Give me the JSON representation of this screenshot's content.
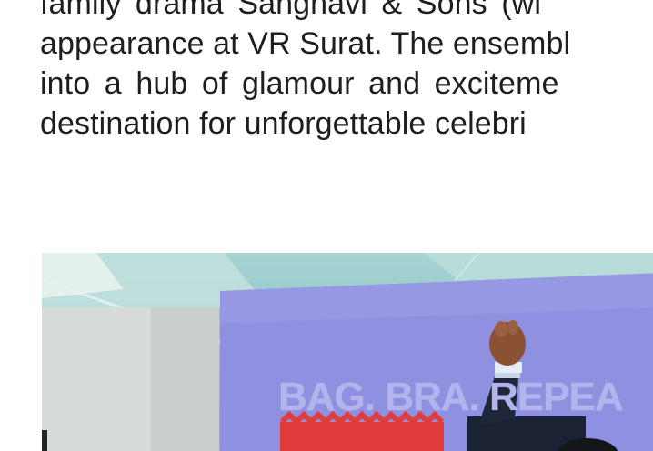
{
  "article": {
    "lines": [
      "family drama Sanghavi & Sons (wi",
      "appearance at VR Surat. The ensembl",
      "into a hub of glamour and exciteme",
      "destination for unforgettable celebri"
    ]
  },
  "photo": {
    "banner_text": "BAG. BRA. REPEA"
  },
  "colors": {
    "text": "#1e1e1e",
    "banner_bg": "#8f90e0",
    "banner_text": "#b3b3ee",
    "accent_red": "#e23b3b"
  }
}
